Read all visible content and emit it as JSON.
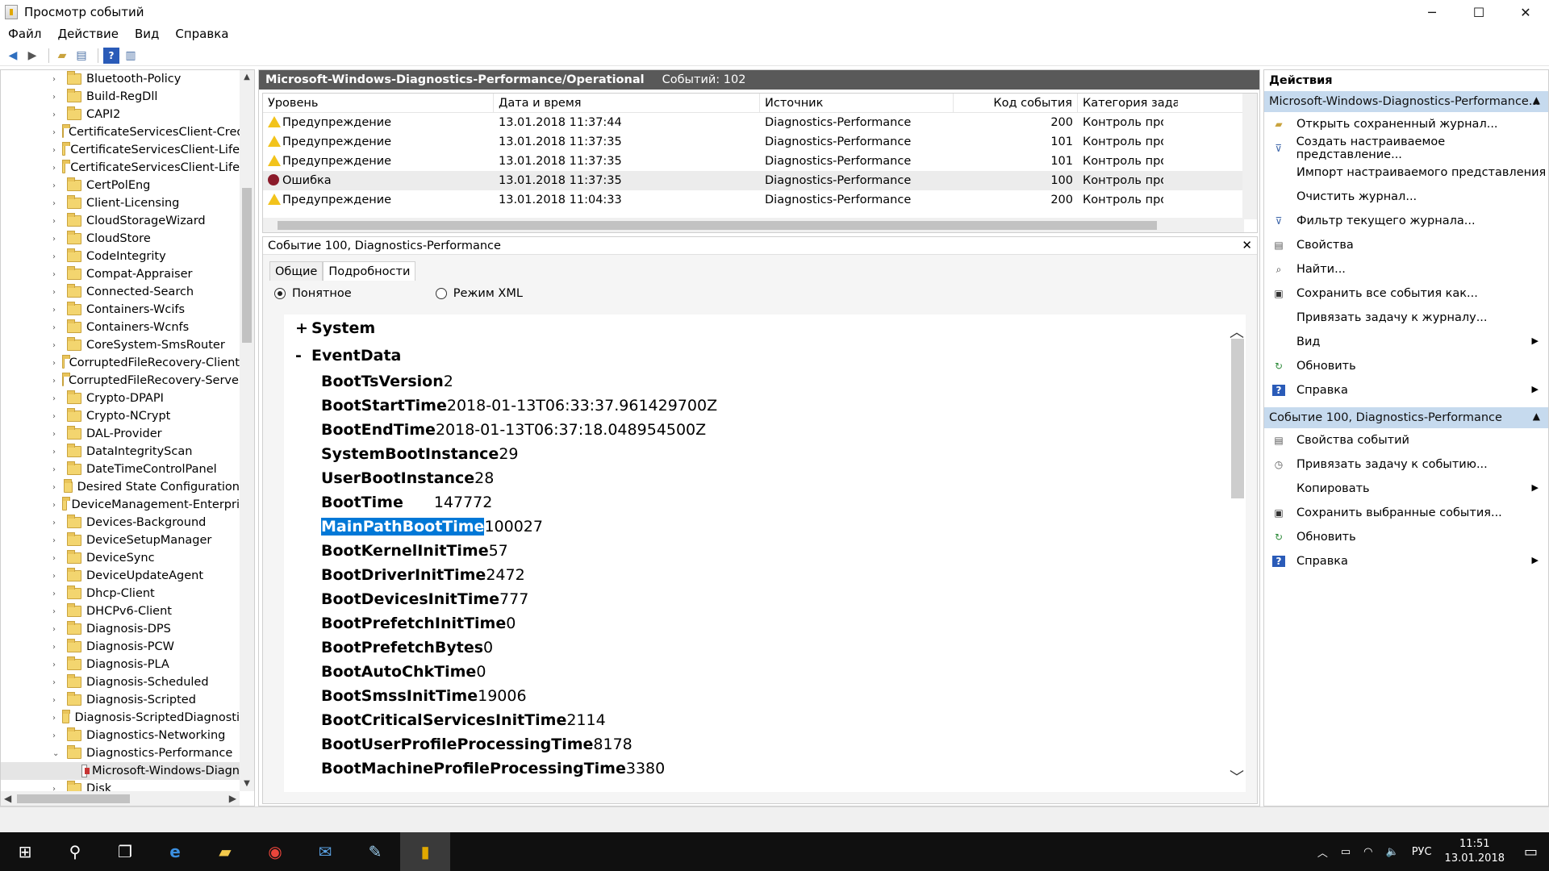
{
  "window": {
    "title": "Просмотр событий",
    "minimize": "─",
    "maximize": "☐",
    "close": "✕"
  },
  "menu": [
    "Файл",
    "Действие",
    "Вид",
    "Справка"
  ],
  "tree": {
    "items": [
      "Bluetooth-Policy",
      "Build-RegDll",
      "CAPI2",
      "CertificateServicesClient-Cred",
      "CertificateServicesClient-Life",
      "CertificateServicesClient-Life",
      "CertPolEng",
      "Client-Licensing",
      "CloudStorageWizard",
      "CloudStore",
      "CodeIntegrity",
      "Compat-Appraiser",
      "Connected-Search",
      "Containers-Wcifs",
      "Containers-Wcnfs",
      "CoreSystem-SmsRouter",
      "CorruptedFileRecovery-Client",
      "CorruptedFileRecovery-Server",
      "Crypto-DPAPI",
      "Crypto-NCrypt",
      "DAL-Provider",
      "DataIntegrityScan",
      "DateTimeControlPanel",
      "Desired State Configuration",
      "DeviceManagement-Enterpri",
      "Devices-Background",
      "DeviceSetupManager",
      "DeviceSync",
      "DeviceUpdateAgent",
      "Dhcp-Client",
      "DHCPv6-Client",
      "Diagnosis-DPS",
      "Diagnosis-PCW",
      "Diagnosis-PLA",
      "Diagnosis-Scheduled",
      "Diagnosis-Scripted",
      "Diagnosis-ScriptedDiagnosti",
      "Diagnostics-Networking",
      "Diagnostics-Performance"
    ],
    "selected_log": "Microsoft-Windows-Diagn",
    "last": "Disk"
  },
  "log": {
    "name": "Microsoft-Windows-Diagnostics-Performance/Operational",
    "count": "Событий: 102"
  },
  "grid": {
    "headers": [
      "Уровень",
      "Дата и время",
      "Источник",
      "Код события",
      "Категория задачи"
    ],
    "rows": [
      {
        "level": "Предупреждение",
        "type": "warn",
        "date": "13.01.2018 11:37:44",
        "source": "Diagnostics-Performance",
        "code": "200",
        "category": "Контроль производительности"
      },
      {
        "level": "Предупреждение",
        "type": "warn",
        "date": "13.01.2018 11:37:35",
        "source": "Diagnostics-Performance",
        "code": "101",
        "category": "Контроль производительности"
      },
      {
        "level": "Предупреждение",
        "type": "warn",
        "date": "13.01.2018 11:37:35",
        "source": "Diagnostics-Performance",
        "code": "101",
        "category": "Контроль производительности"
      },
      {
        "level": "Ошибка",
        "type": "err",
        "date": "13.01.2018 11:37:35",
        "source": "Diagnostics-Performance",
        "code": "100",
        "category": "Контроль производительности"
      },
      {
        "level": "Предупреждение",
        "type": "warn",
        "date": "13.01.2018 11:04:33",
        "source": "Diagnostics-Performance",
        "code": "200",
        "category": "Контроль производительности"
      }
    ]
  },
  "detail": {
    "title": "Событие 100, Diagnostics-Performance",
    "tabs": [
      "Общие",
      "Подробности"
    ],
    "radio_friendly": "Понятное",
    "radio_xml": "Режим XML",
    "system_label": "System",
    "eventdata_label": "EventData",
    "fields": [
      {
        "k": "BootTsVersion",
        "v": "2"
      },
      {
        "k": "BootStartTime",
        "v": "2018-01-13T06:33:37.961429700Z"
      },
      {
        "k": "BootEndTime",
        "v": "2018-01-13T06:37:18.048954500Z"
      },
      {
        "k": "SystemBootInstance",
        "v": "29"
      },
      {
        "k": "UserBootInstance",
        "v": "28"
      },
      {
        "k": "BootTime",
        "v": "147772"
      },
      {
        "k": "MainPathBootTime",
        "v": "100027"
      },
      {
        "k": "BootKernelInitTime",
        "v": "57"
      },
      {
        "k": "BootDriverInitTime",
        "v": "2472"
      },
      {
        "k": "BootDevicesInitTime",
        "v": "777"
      },
      {
        "k": "BootPrefetchInitTime",
        "v": "0"
      },
      {
        "k": "BootPrefetchBytes",
        "v": "0"
      },
      {
        "k": "BootAutoChkTime",
        "v": "0"
      },
      {
        "k": "BootSmssInitTime",
        "v": "19006"
      },
      {
        "k": "BootCriticalServicesInitTime",
        "v": "2114"
      },
      {
        "k": "BootUserProfileProcessingTime",
        "v": "8178"
      },
      {
        "k": "BootMachineProfileProcessingTime",
        "v": "3380"
      }
    ]
  },
  "actions": {
    "title": "Действия",
    "group1": "Microsoft-Windows-Diagnostics-Performance...",
    "items1": [
      "Открыть сохраненный журнал...",
      "Создать настраиваемое представление...",
      "Импорт настраиваемого представления",
      "Очистить журнал...",
      "Фильтр текущего журнала...",
      "Свойства",
      "Найти...",
      "Сохранить все события как...",
      "Привязать задачу к журналу...",
      "Вид",
      "Обновить",
      "Справка"
    ],
    "group2": "Событие 100, Diagnostics-Performance",
    "items2": [
      "Свойства событий",
      "Привязать задачу к событию...",
      "Копировать",
      "Сохранить выбранные события...",
      "Обновить",
      "Справка"
    ]
  },
  "tray": {
    "lang": "РУС",
    "time": "11:51",
    "date": "13.01.2018"
  }
}
